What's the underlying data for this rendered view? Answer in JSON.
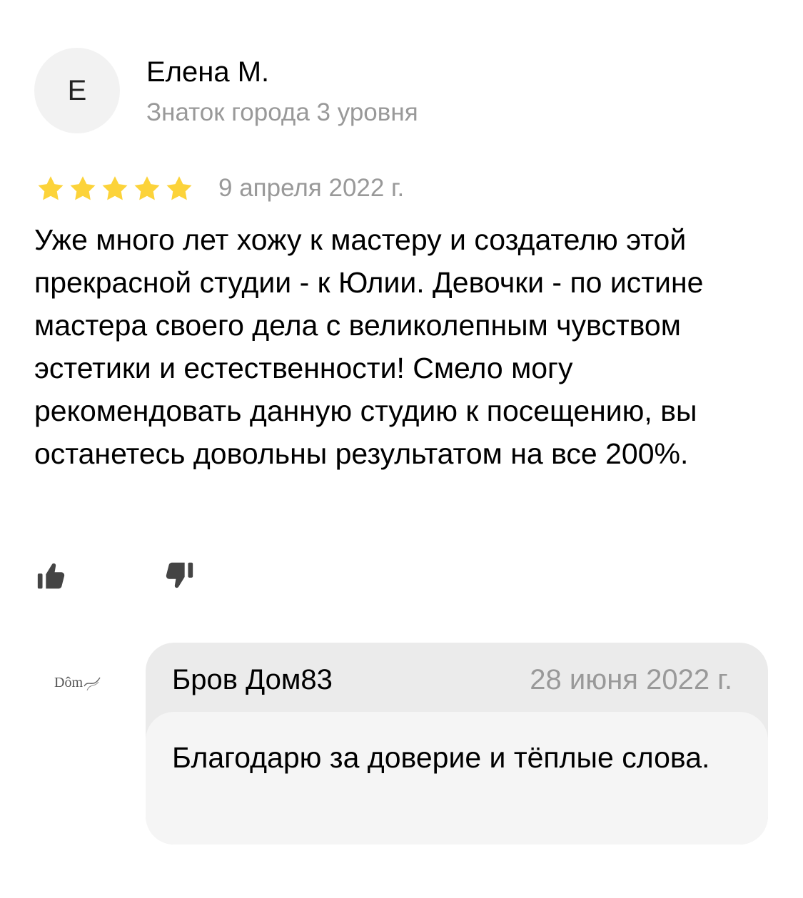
{
  "review": {
    "avatar_letter": "Е",
    "author_name": "Елена М.",
    "author_level": "Знаток города 3 уровня",
    "rating": 5,
    "rating_max": 5,
    "star_color": "#fcd33a",
    "date": "9 апреля 2022 г.",
    "text": "Уже много лет хожу к мастеру и создателю этой прекрасной студии - к Юлии. Девочки - по истине мастера своего дела с великолепным чувством эстетики и естественности! Смело могу рекомендовать данную студию к посещению, вы останетесь довольны результатом на все 200%.",
    "actions": {
      "like_icon": "thumbs-up-icon",
      "dislike_icon": "thumbs-down-icon"
    }
  },
  "reply": {
    "owner_logo_text": "Dôm",
    "author": "Бров Дом83",
    "date": "28 июня 2022 г.",
    "text": "Благодарю за доверие и тёплые слова."
  },
  "colors": {
    "secondary_text": "#999999",
    "avatar_bg": "#f2f2f2",
    "reply_header_bg": "#ebebeb",
    "reply_body_bg": "#f5f5f5"
  }
}
